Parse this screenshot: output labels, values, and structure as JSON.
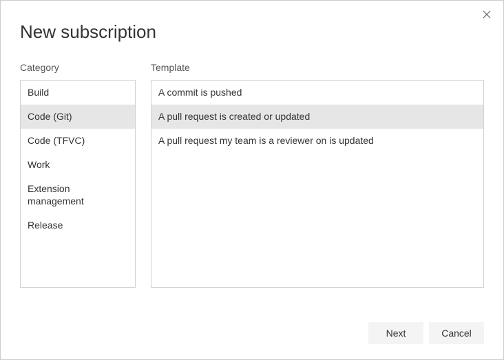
{
  "dialog": {
    "title": "New subscription",
    "category_label": "Category",
    "template_label": "Template"
  },
  "categories": {
    "items": [
      {
        "label": "Build",
        "selected": false
      },
      {
        "label": "Code (Git)",
        "selected": true
      },
      {
        "label": "Code (TFVC)",
        "selected": false
      },
      {
        "label": "Work",
        "selected": false
      },
      {
        "label": "Extension management",
        "selected": false
      },
      {
        "label": "Release",
        "selected": false
      }
    ]
  },
  "templates": {
    "items": [
      {
        "label": "A commit is pushed",
        "selected": false
      },
      {
        "label": "A pull request is created or updated",
        "selected": true
      },
      {
        "label": "A pull request my team is a reviewer on is updated",
        "selected": false
      }
    ]
  },
  "buttons": {
    "next": "Next",
    "cancel": "Cancel"
  }
}
